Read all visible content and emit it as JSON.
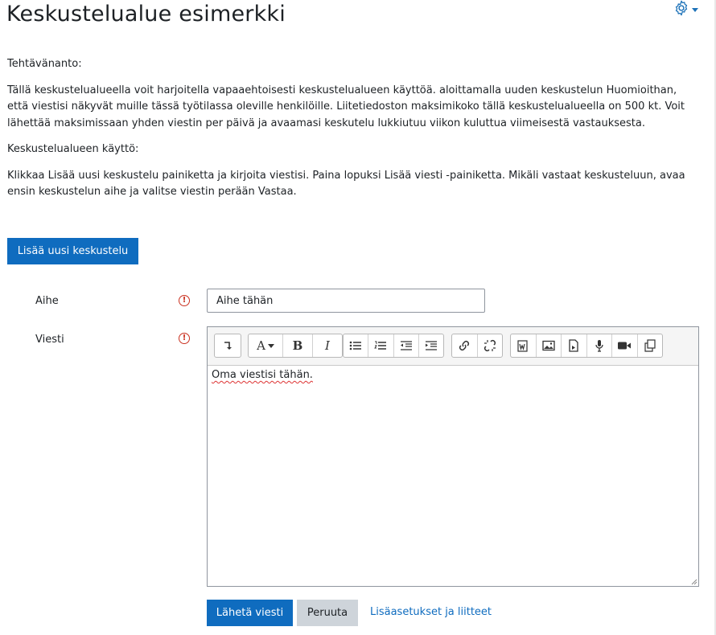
{
  "page": {
    "title": "Keskustelualue esimerkki"
  },
  "description": {
    "p1": "Tehtävänanto:",
    "p2": "Tällä keskustelualueella voit harjoitella vapaaehtoisesti keskustelualueen käyttöä. aloittamalla uuden keskustelun Huomioithan, että viestisi näkyvät muille tässä työtilassa oleville henkilöille. Liitetiedoston maksimikoko tällä keskustelualueella on 500 kt. Voit lähettää maksimissaan yhden viestin per päivä ja avaamasi keskutelu lukkiutuu viikon kuluttua viimeisestä vastauksesta.",
    "p3": "Keskustelualueen käyttö:",
    "p4": "Klikkaa Lisää uusi keskustelu painiketta ja kirjoita viestisi. Paina lopuksi Lisää viesti -painiketta. Mikäli vastaat keskusteluun, avaa ensin keskustelun aihe ja valitse viestin perään Vastaa."
  },
  "actions": {
    "add_discussion": "Lisää uusi keskustelu"
  },
  "form": {
    "subject_label": "Aihe",
    "subject_value": "Aihe tähän",
    "message_label": "Viesti",
    "required_mark": "!",
    "message_value": "Oma viestisi tähän.",
    "submit_label": "Lähetä viesti",
    "cancel_label": "Peruuta",
    "advanced_link": "Lisäasetukset ja liitteet"
  },
  "toolbar": {
    "font_glyph": "A",
    "bold_glyph": "B",
    "italic_glyph": "I",
    "icons": [
      "toggle-toolbar-icon",
      "font-color-icon",
      "bold-icon",
      "italic-icon",
      "unordered-list-icon",
      "ordered-list-icon",
      "outdent-icon",
      "indent-icon",
      "link-icon",
      "unlink-icon",
      "paste-word-icon",
      "image-icon",
      "media-icon",
      "record-audio-icon",
      "record-video-icon",
      "manage-files-icon"
    ]
  },
  "colors": {
    "primary": "#0f6cbf",
    "required": "#ca3120",
    "secondary": "#ced4da"
  }
}
